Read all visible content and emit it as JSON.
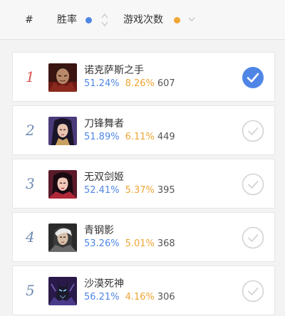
{
  "header": {
    "hash_label": "#",
    "win_rate_label": "胜率",
    "games_label": "游戏次数",
    "accent_blue": "#4f86e6",
    "accent_orange": "#f0a534"
  },
  "rows": [
    {
      "rank": "1",
      "name": "诺克萨斯之手",
      "win_rate": "51.24%",
      "pick_rate": "8.26%",
      "games": "607",
      "selected": true,
      "avatar_icon": "darius-portrait"
    },
    {
      "rank": "2",
      "name": "刀锋舞者",
      "win_rate": "51.89%",
      "pick_rate": "6.11%",
      "games": "449",
      "selected": false,
      "avatar_icon": "irelia-portrait"
    },
    {
      "rank": "3",
      "name": "无双剑姬",
      "win_rate": "52.41%",
      "pick_rate": "5.37%",
      "games": "395",
      "selected": false,
      "avatar_icon": "fiora-portrait"
    },
    {
      "rank": "4",
      "name": "青钢影",
      "win_rate": "53.26%",
      "pick_rate": "5.01%",
      "games": "368",
      "selected": false,
      "avatar_icon": "camille-portrait"
    },
    {
      "rank": "5",
      "name": "沙漠死神",
      "win_rate": "56.21%",
      "pick_rate": "4.16%",
      "games": "306",
      "selected": false,
      "avatar_icon": "nasus-portrait"
    }
  ]
}
